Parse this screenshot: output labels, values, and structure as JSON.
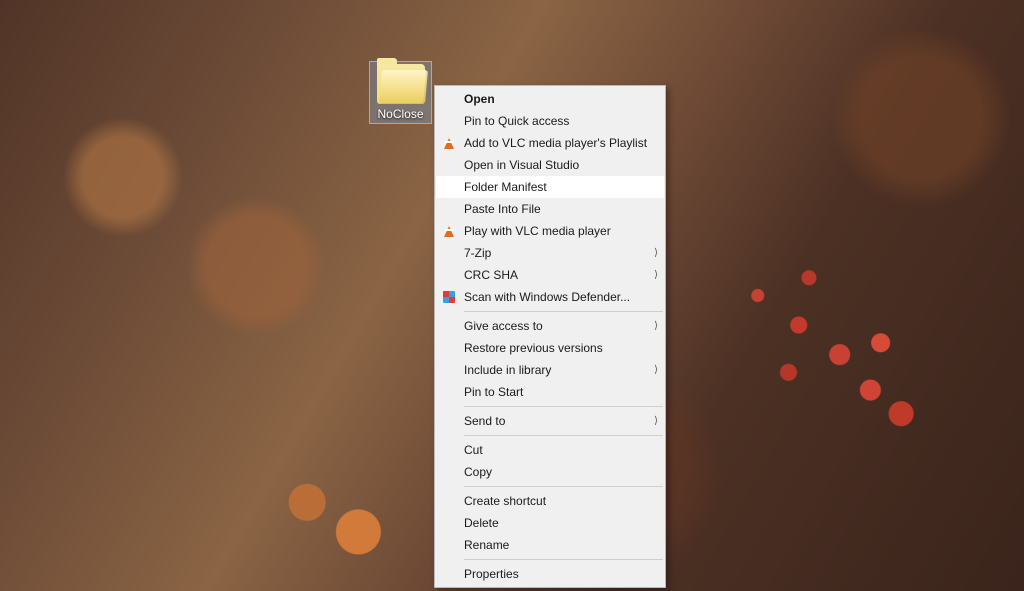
{
  "desktop_icon": {
    "label": "NoClose",
    "type": "folder"
  },
  "context_menu": {
    "groups": [
      [
        {
          "label": "Open",
          "bold": true
        },
        {
          "label": "Pin to Quick access"
        },
        {
          "label": "Add to VLC media player's Playlist",
          "icon": "vlc"
        },
        {
          "label": "Open in Visual Studio"
        },
        {
          "label": "Folder Manifest",
          "hover": true
        },
        {
          "label": "Paste Into File"
        },
        {
          "label": "Play with VLC media player",
          "icon": "vlc"
        },
        {
          "label": "7-Zip",
          "submenu": true
        },
        {
          "label": "CRC SHA",
          "submenu": true
        },
        {
          "label": "Scan with Windows Defender...",
          "icon": "shield"
        }
      ],
      [
        {
          "label": "Give access to",
          "submenu": true
        },
        {
          "label": "Restore previous versions"
        },
        {
          "label": "Include in library",
          "submenu": true
        },
        {
          "label": "Pin to Start"
        }
      ],
      [
        {
          "label": "Send to",
          "submenu": true
        }
      ],
      [
        {
          "label": "Cut"
        },
        {
          "label": "Copy"
        }
      ],
      [
        {
          "label": "Create shortcut"
        },
        {
          "label": "Delete"
        },
        {
          "label": "Rename"
        }
      ],
      [
        {
          "label": "Properties"
        }
      ]
    ]
  }
}
